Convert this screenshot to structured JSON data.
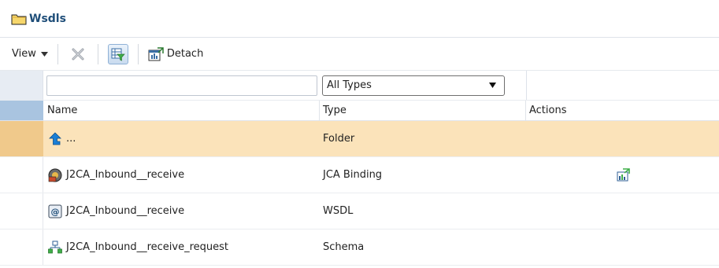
{
  "title": "Wsdls",
  "toolbar": {
    "view_label": "View",
    "detach_label": "Detach"
  },
  "filter": {
    "name_value": "",
    "type_selected": "All Types"
  },
  "columns": {
    "name": "Name",
    "type": "Type",
    "actions": "Actions"
  },
  "rows": [
    {
      "name": "...",
      "type": "Folder",
      "icon": "up-arrow-icon",
      "selected": true
    },
    {
      "name": "J2CA_Inbound__receive",
      "type": "JCA Binding",
      "icon": "jca-binding-icon",
      "action_icon": "test-action-icon"
    },
    {
      "name": "J2CA_Inbound__receive",
      "type": "WSDL",
      "icon": "wsdl-icon"
    },
    {
      "name": "J2CA_Inbound__receive_request",
      "type": "Schema",
      "icon": "schema-icon"
    }
  ],
  "colors": {
    "selected_row": "#fbe3ba",
    "header_stub": "#a9c4e0",
    "title": "#1f4e79"
  }
}
